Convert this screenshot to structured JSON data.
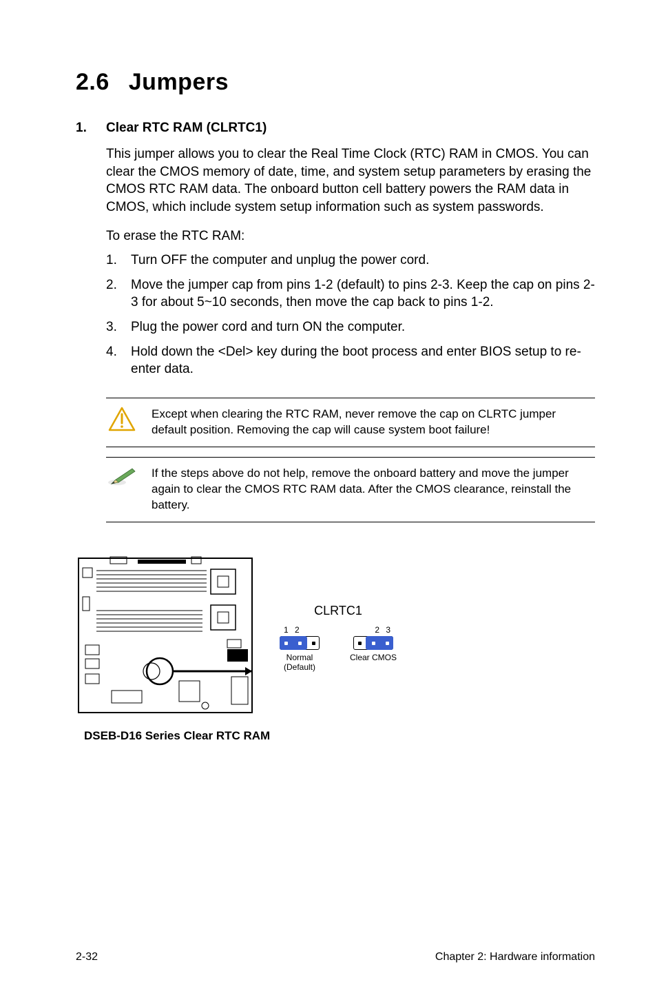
{
  "heading": {
    "number": "2.6",
    "title": "Jumpers"
  },
  "section1": {
    "index": "1.",
    "title": "Clear RTC RAM (CLRTC1)",
    "para1": "This jumper allows you to clear the  Real Time Clock (RTC) RAM in CMOS. You can clear the CMOS memory of date, time, and system setup parameters by erasing the CMOS RTC RAM data. The onboard button cell battery powers the RAM data in CMOS, which include system setup information such as system passwords.",
    "para2": "To erase the RTC RAM:",
    "steps": [
      {
        "n": "1.",
        "t": "Turn OFF the computer and unplug the power cord."
      },
      {
        "n": "2.",
        "t": "Move the jumper cap from pins 1-2 (default) to pins 2-3. Keep the cap on pins 2-3 for about 5~10 seconds, then move the cap back to pins  1-2."
      },
      {
        "n": "3.",
        "t": "Plug the power cord and turn ON the computer."
      },
      {
        "n": "4.",
        "t": "Hold down the <Del> key during the boot process and enter BIOS setup to re-enter data."
      }
    ]
  },
  "notes": {
    "warn": "Except when clearing the RTC RAM, never remove the cap on CLRTC jumper default position. Removing the cap will cause system boot failure!",
    "info": "If the steps above do not help, remove the onboard battery and move the jumper again to clear the CMOS RTC RAM data. After the CMOS clearance, reinstall the battery."
  },
  "figure": {
    "header_label": "CLRTC1",
    "normal_pins": "1  2",
    "clear_pins": "2  3",
    "normal_label_l1": "Normal",
    "normal_label_l2": "(Default)",
    "clear_label": "Clear CMOS",
    "caption": "DSEB-D16 Series Clear RTC RAM"
  },
  "footer": {
    "left": "2-32",
    "right": "Chapter 2: Hardware information"
  },
  "icons": {
    "warning": "warning-triangle-icon",
    "note": "pencil-icon"
  }
}
